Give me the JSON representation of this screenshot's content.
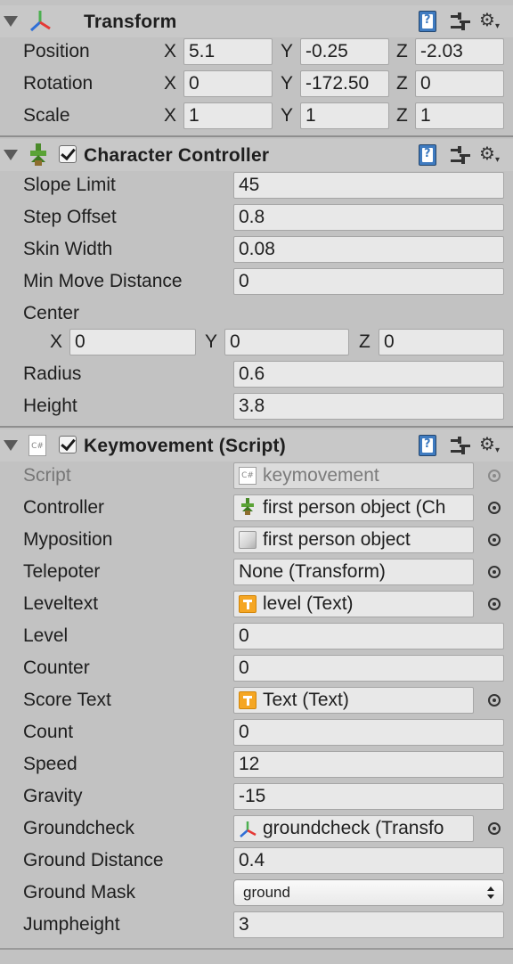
{
  "transform": {
    "title": "Transform",
    "position": {
      "label": "Position",
      "x": "5.1",
      "y": "-0.25",
      "z": "-2.03"
    },
    "rotation": {
      "label": "Rotation",
      "x": "0",
      "y": "-172.50",
      "z": "0"
    },
    "scale": {
      "label": "Scale",
      "x": "1",
      "y": "1",
      "z": "1"
    }
  },
  "axes": {
    "x": "X",
    "y": "Y",
    "z": "Z"
  },
  "character_controller": {
    "title": "Character Controller",
    "enabled": true,
    "fields": [
      {
        "label": "Slope Limit",
        "value": "45"
      },
      {
        "label": "Step Offset",
        "value": "0.8"
      },
      {
        "label": "Skin Width",
        "value": "0.08"
      },
      {
        "label": "Min Move Distance",
        "value": "0"
      }
    ],
    "center": {
      "label": "Center",
      "x": "0",
      "y": "0",
      "z": "0"
    },
    "radius": {
      "label": "Radius",
      "value": "0.6"
    },
    "height": {
      "label": "Height",
      "value": "3.8"
    }
  },
  "keymovement": {
    "title": "Keymovement (Script)",
    "enabled": true,
    "script": {
      "label": "Script",
      "value": "keymovement",
      "icon": "csharp-script-icon"
    },
    "controller": {
      "label": "Controller",
      "value": "first person object (Ch",
      "icon": "character-controller-icon"
    },
    "myposition": {
      "label": "Myposition",
      "value": "first person object",
      "icon": "gameobject-cube-icon"
    },
    "telepoter": {
      "label": "Telepoter",
      "value": "None (Transform)"
    },
    "leveltext": {
      "label": "Leveltext",
      "value": "level (Text)",
      "icon": "text-icon"
    },
    "level": {
      "label": "Level",
      "value": "0"
    },
    "counter": {
      "label": "Counter",
      "value": "0"
    },
    "score_text": {
      "label": "Score Text",
      "value": "Text (Text)",
      "icon": "text-icon"
    },
    "count": {
      "label": "Count",
      "value": "0"
    },
    "speed": {
      "label": "Speed",
      "value": "12"
    },
    "gravity": {
      "label": "Gravity",
      "value": "-15"
    },
    "groundcheck": {
      "label": "Groundcheck",
      "value": "groundcheck (Transfo",
      "icon": "transform-icon"
    },
    "ground_distance": {
      "label": "Ground Distance",
      "value": "0.4"
    },
    "ground_mask": {
      "label": "Ground Mask",
      "value": "ground"
    },
    "jumpheight": {
      "label": "Jumpheight",
      "value": "3"
    }
  },
  "colors": {
    "panel": "#c2c2c2",
    "field": "#e8e8e8",
    "help_blue": "#3f7bc0",
    "text_icon": "#f5a623"
  }
}
